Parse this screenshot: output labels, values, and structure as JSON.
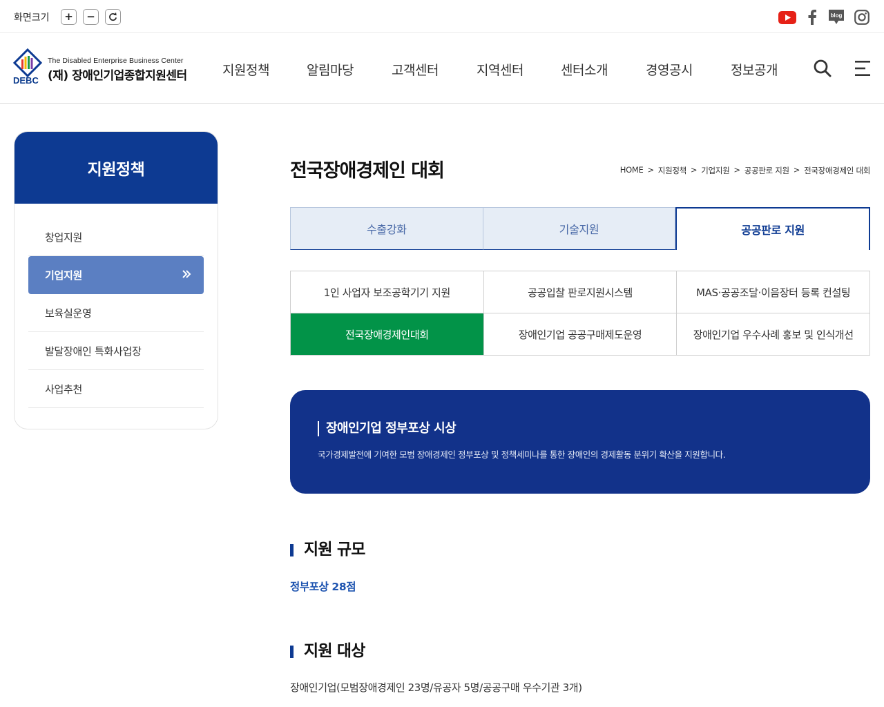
{
  "util": {
    "zoom_label": "화면크기",
    "zoom_in": "+",
    "zoom_out": "−",
    "reset_icon": "refresh-icon",
    "sns": [
      "youtube-icon",
      "facebook-icon",
      "blog-icon",
      "instagram-icon"
    ],
    "blog_text": "blog"
  },
  "logo": {
    "english": "The Disabled Enterprise Business Center",
    "korean": "(재) 장애인기업종합지원센터",
    "abbr": "DEBC"
  },
  "gnb": [
    "지원정책",
    "알림마당",
    "고객센터",
    "지역센터",
    "센터소개",
    "경영공시",
    "정보공개"
  ],
  "lnb": {
    "title": "지원정책",
    "items": [
      "창업지원",
      "기업지원",
      "보육실운영",
      "발달장애인 특화사업장",
      "사업추천"
    ],
    "active_index": 1
  },
  "page": {
    "title": "전국장애경제인 대회",
    "breadcrumb": [
      "HOME",
      "지원정책",
      "기업지원",
      "공공판로 지원",
      "전국장애경제인 대회"
    ],
    "breadcrumb_sep": ">"
  },
  "tabs": [
    "수출강화",
    "기술지원",
    "공공판로 지원"
  ],
  "subtabs": [
    "1인 사업자 보조공학기기 지원",
    "공공입찰 판로지원시스템",
    "MAS·공공조달·이음장터 등록 컨설팅",
    "전국장애경제인대회",
    "장애인기업 공공구매제도운영",
    "장애인기업 우수사례 홍보 및 인식개선"
  ],
  "banner": {
    "title": "장애인기업 정부포상 시상",
    "desc": "국가경제발전에 기여한 모범 장애경제인 정부포상 및 정책세미나를 통한 장애인의 경제활동 분위기 확산을 지원합니다."
  },
  "sections": {
    "scale_title": "지원 규모",
    "scale_value": "정부포상 28점",
    "target_title": "지원 대상",
    "target_text": "장애인기업(모범장애경제인 23명/유공자 5명/공공구매 우수기관 3개)"
  },
  "colors": {
    "primary": "#0d3a92",
    "active_lnb": "#5b7fc2",
    "green": "#029348",
    "banner": "#12328a"
  }
}
